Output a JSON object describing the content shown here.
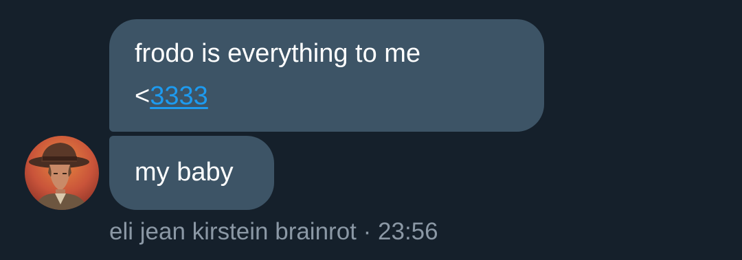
{
  "conversation": {
    "messages": [
      {
        "line1": "frodo is everything to me",
        "line2_prefix": "<",
        "line2_link": "3333"
      },
      {
        "text": "my baby"
      }
    ],
    "sender_name": "eli jean kirstein brainrot",
    "separator": "·",
    "timestamp": "23:56"
  },
  "colors": {
    "background": "#15202b",
    "bubble": "#3d5466",
    "link": "#1d9bf0",
    "meta_text": "#8b98a5"
  },
  "icons": {
    "avatar": "profile-avatar-illustration"
  }
}
